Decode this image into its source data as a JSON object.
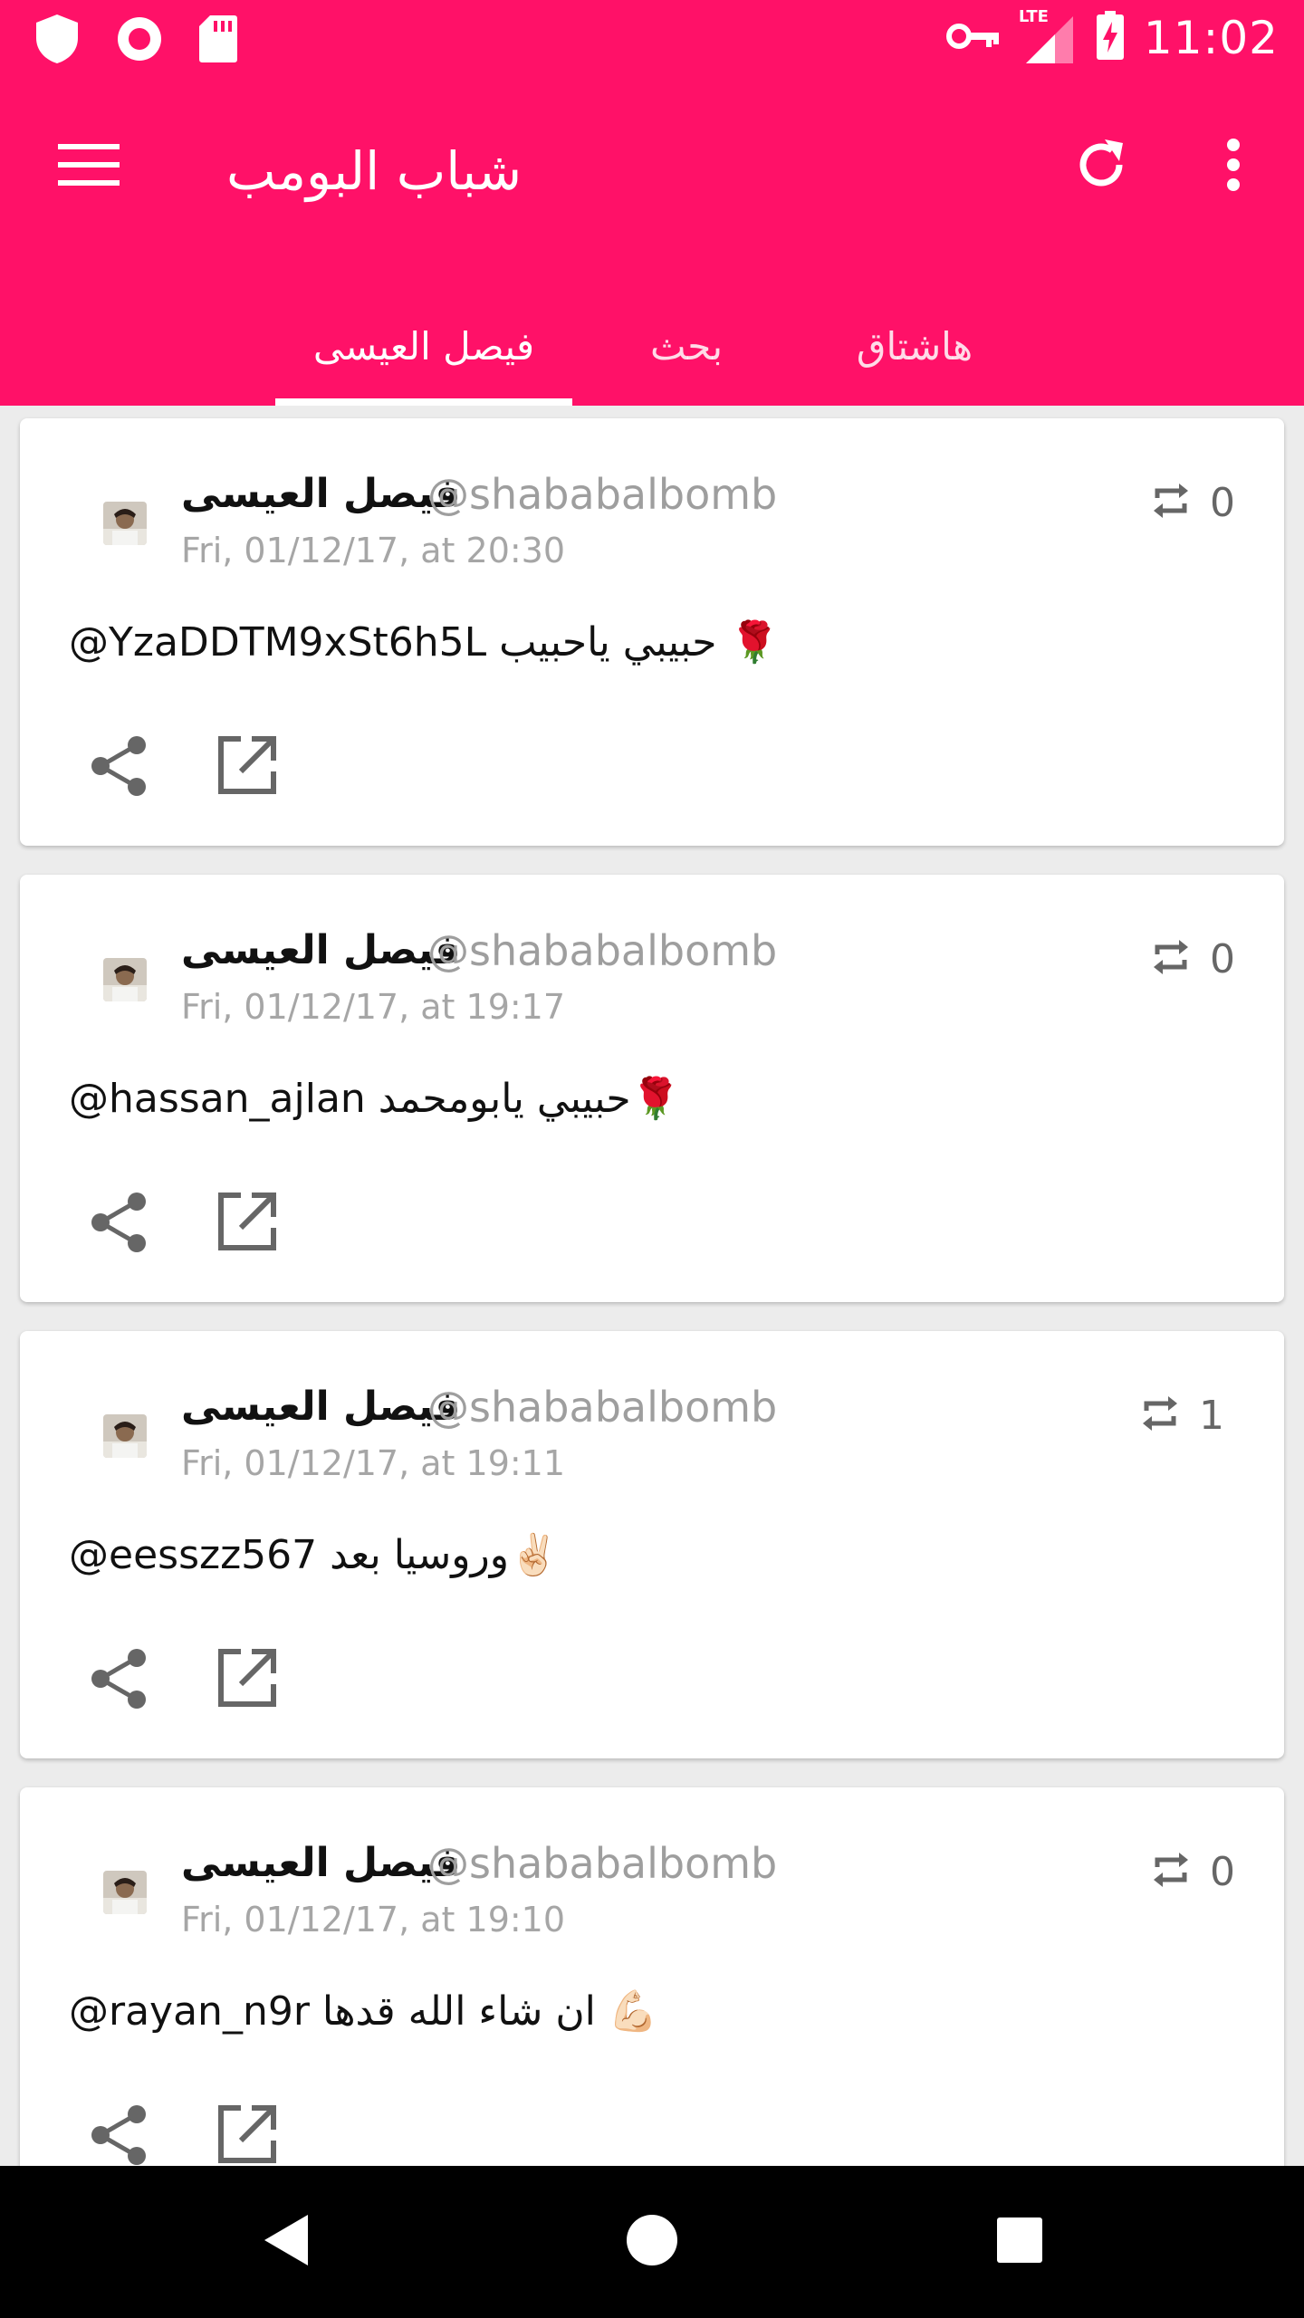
{
  "status_bar": {
    "time": "11:02",
    "network": "LTE",
    "icons": [
      "shield-icon",
      "record-icon",
      "sd-card-icon",
      "vpn-key-icon",
      "signal-icon",
      "battery-charging-icon"
    ]
  },
  "app_bar": {
    "title": "شباب البومب",
    "menu_icon": "menu-icon",
    "refresh_icon": "refresh-icon",
    "more_icon": "more-vert-icon"
  },
  "tabs": [
    {
      "label": "فيصل العيسى",
      "selected": true
    },
    {
      "label": "بحث",
      "selected": false
    },
    {
      "label": "هاشتاق",
      "selected": false
    }
  ],
  "colors": {
    "primary": "#ff1168",
    "icon_gray": "#666666",
    "secondary_text": "#9e9e9e"
  },
  "tweets": [
    {
      "author": "فيصل العيسى",
      "handle": "@shababalbomb",
      "time": "Fri, 01/12/17, at 20:30",
      "retweets": "0",
      "text": "@YzaDDTM9xSt6h5L حبيبي ياحبيب 🌹"
    },
    {
      "author": "فيصل العيسى",
      "handle": "@shababalbomb",
      "time": "Fri, 01/12/17, at 19:17",
      "retweets": "0",
      "text": "@hassan_ajlan حبيبي يابومحمد🌹"
    },
    {
      "author": "فيصل العيسى",
      "handle": "@shababalbomb",
      "time": "Fri, 01/12/17, at 19:11",
      "retweets": "1",
      "text": "@eesszz567 وروسيا بعد✌🏻"
    },
    {
      "author": "فيصل العيسى",
      "handle": "@shababalbomb",
      "time": "Fri, 01/12/17, at 19:10",
      "retweets": "0",
      "text": "@rayan_n9r ان شاء الله قدها 💪🏻"
    }
  ],
  "nav_bar": {
    "back_icon": "back-icon",
    "home_icon": "home-icon",
    "recents_icon": "recents-icon"
  }
}
